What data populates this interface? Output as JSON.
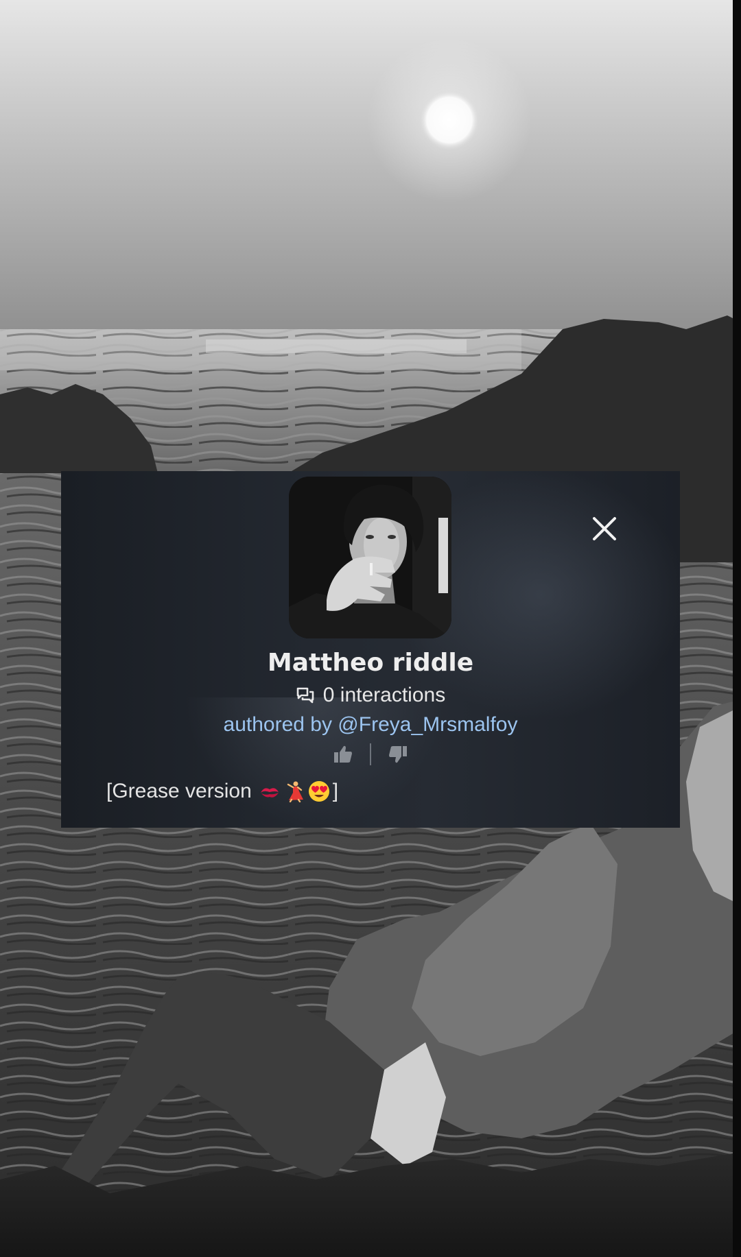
{
  "character": {
    "name": "Mattheo riddle",
    "interactions": "0 interactions",
    "author": "authored by @Freya_Mrsmalfoy",
    "description_text": "[Grease version",
    "description_close": "]",
    "description_emojis": [
      "kiss-mark-emoji",
      "dancer-emoji",
      "heart-eyes-emoji"
    ]
  },
  "icons": {
    "close": "close-icon",
    "interactions": "chat-bubbles-icon",
    "like": "thumbs-up-icon",
    "dislike": "thumbs-down-icon"
  },
  "colors": {
    "card_background": "#232830",
    "title": "#eeeeee",
    "author_link": "#9cc4ef",
    "text": "#e4e4e4",
    "vote_icons": "#8a8f96"
  }
}
